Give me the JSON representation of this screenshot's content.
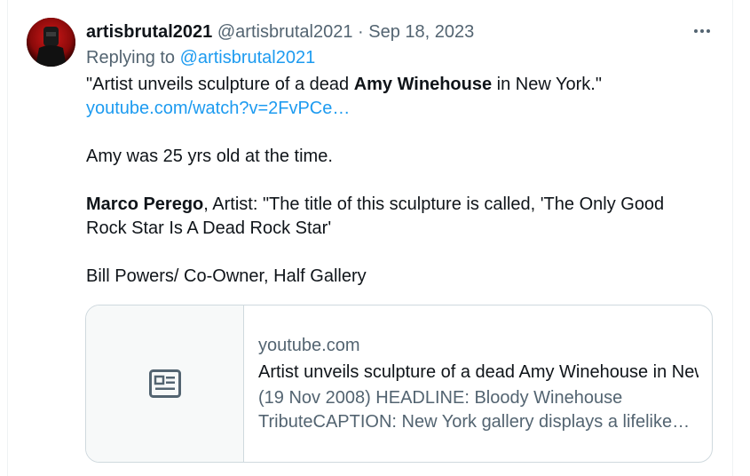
{
  "tweet": {
    "author": {
      "display_name": "artisbrutal2021",
      "handle": "@artisbrutal2021",
      "avatar_icon": "avatar-figure-icon"
    },
    "separator": " · ",
    "date": "Sep 18, 2023",
    "more_icon": "more-dots-icon",
    "replying_to_label": "Replying to ",
    "replying_to_handle": "@artisbrutal2021",
    "body": {
      "line1_prefix": "\"Artist unveils sculpture of a dead ",
      "line1_bold": "Amy Winehouse",
      "line1_suffix": " in New York.\"",
      "link_text": "youtube.com/watch?v=2FvPCe…",
      "para2": "Amy was 25 yrs old at the time.",
      "para3_bold": "Marco Perego",
      "para3_rest": ", Artist: \"The title of this sculpture is called, 'The Only Good Rock Star Is A Dead Rock Star'",
      "para4": "Bill Powers/ Co-Owner, Half Gallery"
    },
    "card": {
      "thumb_icon": "article-icon",
      "domain": "youtube.com",
      "title": "Artist unveils sculpture of a dead Amy Winehouse in New York",
      "description": "(19 Nov 2008) HEADLINE: Bloody Winehouse TributeCAPTION: New York gallery displays a lifelike sculpture"
    }
  },
  "colors": {
    "link": "#1d9bf0",
    "text": "#0f1419",
    "secondary": "#536471",
    "border": "#cfd9de"
  }
}
